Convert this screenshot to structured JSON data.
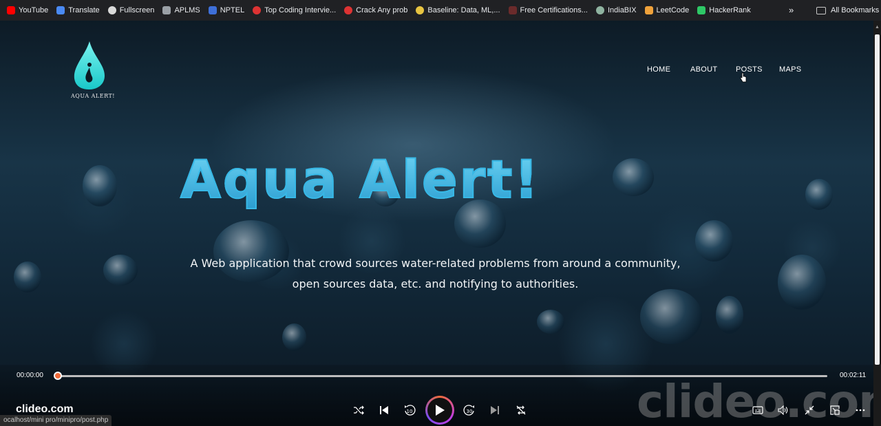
{
  "bookmarks": [
    {
      "label": "YouTube",
      "icon": "youtube-icon",
      "color": "#ff0000"
    },
    {
      "label": "Translate",
      "icon": "translate-icon",
      "color": "#4a8af4"
    },
    {
      "label": "Fullscreen",
      "icon": "fullscreen-icon",
      "color": "#d9d9d9"
    },
    {
      "label": "APLMS",
      "icon": "aplms-icon",
      "color": "#9aa0a6"
    },
    {
      "label": "NPTEL",
      "icon": "nptel-icon",
      "color": "#3e6fd8"
    },
    {
      "label": "Top Coding Intervie...",
      "icon": "tcp-icon",
      "color": "#d33"
    },
    {
      "label": "Crack Any prob",
      "icon": "tcp-icon",
      "color": "#d33"
    },
    {
      "label": "Baseline: Data, ML,...",
      "icon": "baseline-icon",
      "color": "#e8c441"
    },
    {
      "label": "Free Certifications...",
      "icon": "cert-icon",
      "color": "#6b2b2b"
    },
    {
      "label": "IndiaBIX",
      "icon": "indiabix-icon",
      "color": "#8fb3a0"
    },
    {
      "label": "LeetCode",
      "icon": "leetcode-icon",
      "color": "#f0a23b"
    },
    {
      "label": "HackerRank",
      "icon": "hackerrank-icon",
      "color": "#2ec866"
    }
  ],
  "bookmarks_more": "»",
  "all_bookmarks": "All Bookmarks",
  "site": {
    "logo_text": "AQUA ALERT!",
    "nav": [
      "HOME",
      "ABOUT",
      "POSTS",
      "MAPS"
    ],
    "hero_title": "Aqua Alert!",
    "hero_line1": "A Web application that crowd sources water-related problems from around a community,",
    "hero_line2": "open sources data, etc. and notifying to authorities."
  },
  "player": {
    "current_time": "00:00:00",
    "total_time": "00:02:11",
    "progress": 0.0,
    "brand": "clideo.com",
    "watermark": "clideo.com",
    "status_url": "ocalhost/mini pro/minipro/post.php",
    "accent": "#f06b3a"
  }
}
